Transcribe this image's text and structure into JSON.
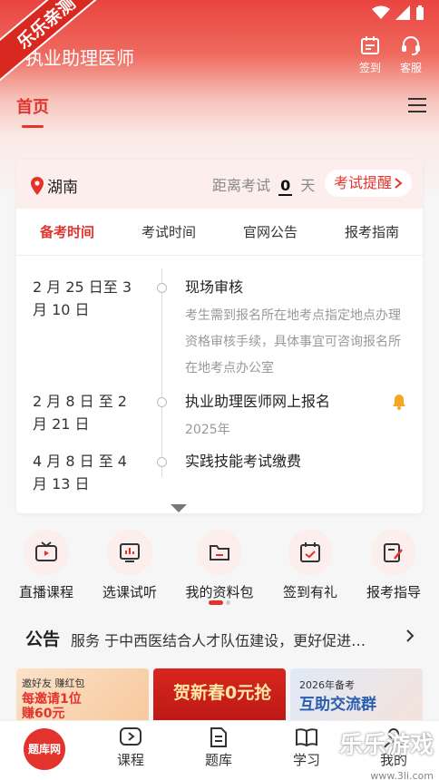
{
  "header": {
    "app_title": "执业助理医师",
    "checkin_label": "签到",
    "service_label": "客服"
  },
  "corner_badge": "乐乐亲测",
  "nav": {
    "home": "首页"
  },
  "exam_card": {
    "location": "湖南",
    "countdown_prefix": "距离考试",
    "countdown_days": "0",
    "countdown_suffix": "天",
    "remind_label": "考试提醒",
    "tabs": [
      {
        "label": "备考时间",
        "active": true
      },
      {
        "label": "考试时间",
        "active": false
      },
      {
        "label": "官网公告",
        "active": false
      },
      {
        "label": "报考指南",
        "active": false
      }
    ],
    "timeline": [
      {
        "date": "2 月 25 日至 3 月 10 日",
        "title": "现场审核",
        "desc": "考生需到报名所在地考点指定地点办理资格审核手续，具体事宜可咨询报名所在地考点办公室",
        "bell": false
      },
      {
        "date": "2 月 8 日 至 2 月 21 日",
        "title": "执业助理医师网上报名",
        "desc": "2025年",
        "bell": true
      },
      {
        "date": "4 月 8 日 至 4 月 13 日",
        "title": "实践技能考试缴费",
        "desc": "",
        "bell": false
      }
    ]
  },
  "shortcuts": [
    {
      "label": "直播课程",
      "icon": "tv-icon"
    },
    {
      "label": "选课试听",
      "icon": "chart-board-icon"
    },
    {
      "label": "我的资料包",
      "icon": "folder-icon"
    },
    {
      "label": "签到有礼",
      "icon": "calendar-check-icon"
    },
    {
      "label": "报考指导",
      "icon": "edit-doc-icon"
    }
  ],
  "notice": {
    "label": "公告",
    "text": "服务 于中西医结合人才队伍建设，更好促进…"
  },
  "banners": [
    {
      "line1": "邀好友 赚红包",
      "line2": "每邀请1位",
      "line3": "赚60元"
    },
    {
      "line1": "贺新春0元抢"
    },
    {
      "line1": "2026年备考",
      "line2": "互助交流群"
    }
  ],
  "bottom_nav": [
    {
      "label": "题库网",
      "icon": "home-logo"
    },
    {
      "label": "课程",
      "icon": "play-icon"
    },
    {
      "label": "题库",
      "icon": "document-icon"
    },
    {
      "label": "学习",
      "icon": "book-icon"
    },
    {
      "label": "我的",
      "icon": "user-icon"
    }
  ],
  "watermark": {
    "text": "乐乐游戏",
    "url": "www.3li.com"
  },
  "colors": {
    "accent": "#e2342d",
    "header_gradient_top": "#e9443f"
  }
}
